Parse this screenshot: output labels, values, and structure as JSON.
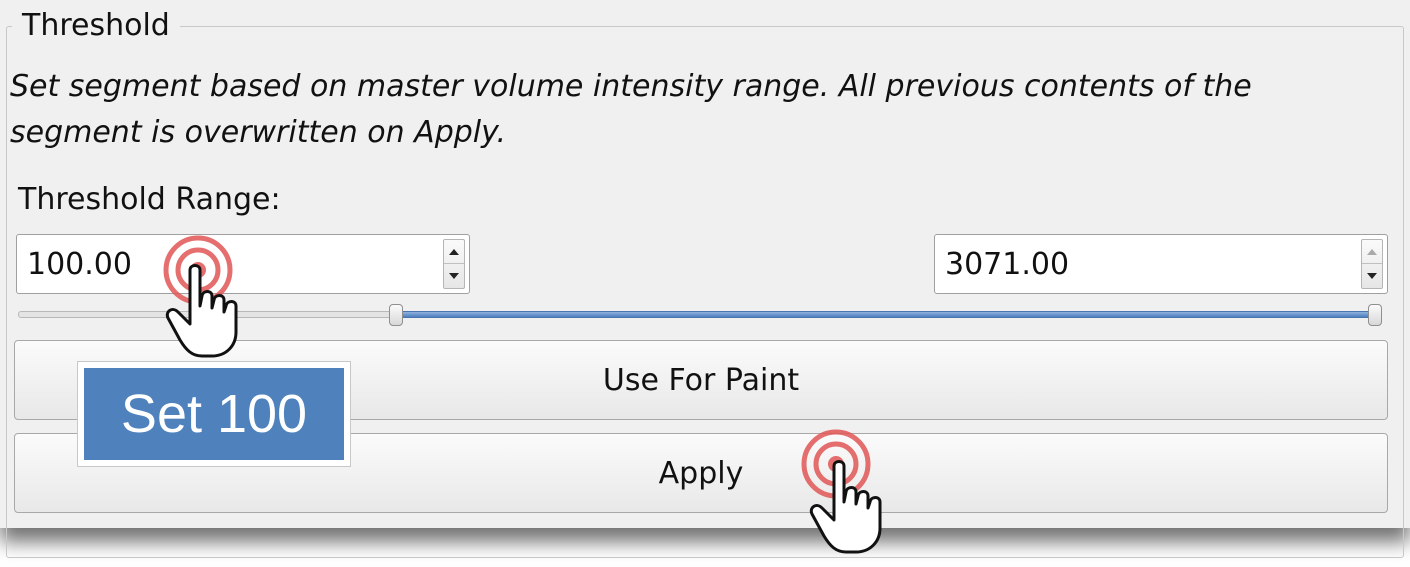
{
  "group": {
    "title": "Threshold",
    "description": "Set segment based on master volume intensity range. All previous contents of the segment is overwritten on Apply."
  },
  "threshold": {
    "label": "Threshold Range:",
    "min_value": "100.00",
    "max_value": "3071.00",
    "slider": {
      "range_min": -1024,
      "range_max": 3071,
      "low": 100,
      "high": 3071
    }
  },
  "buttons": {
    "use_for_paint": "Use For Paint",
    "apply": "Apply"
  },
  "annotation": {
    "callout": "Set 100"
  },
  "colors": {
    "slider_fill": "#4f7fbf",
    "callout_bg": "#4f81bd",
    "click_marker": "#e05555"
  },
  "icons": [
    "click-target-icon",
    "hand-pointer-icon",
    "spin-up-icon",
    "spin-down-icon"
  ]
}
